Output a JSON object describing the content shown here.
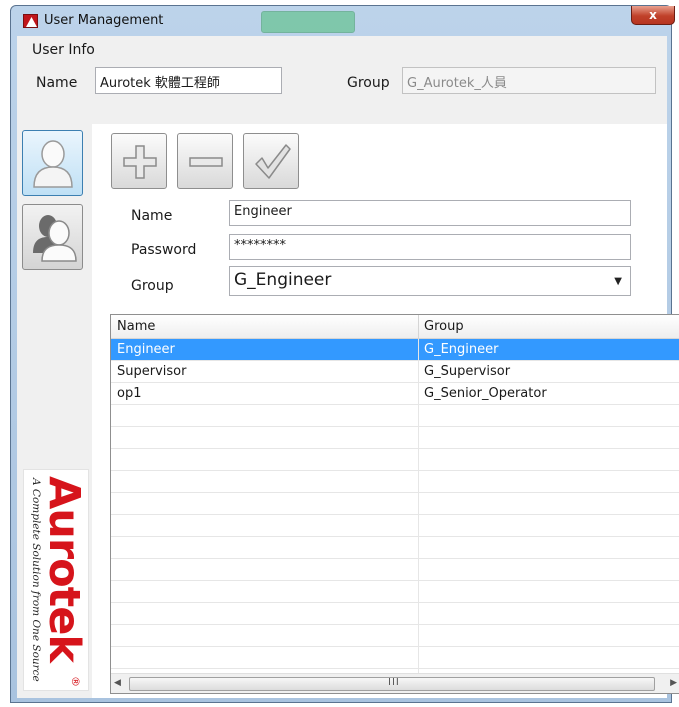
{
  "window": {
    "title": "User Management",
    "close_glyph": "x"
  },
  "user_info": {
    "section_label": "User Info",
    "name_label": "Name",
    "name_value": "Aurotek 軟體工程師",
    "group_label": "Group",
    "group_value": "G_Aurotek_人員"
  },
  "side": {
    "user_mode_icon": "user-icon",
    "group_mode_icon": "user-group-icon",
    "logo": {
      "word": "Aurotek",
      "tagline": "A Complete Solution from One Source",
      "reg_mark": "®"
    }
  },
  "toolbar": {
    "add_icon": "plus-icon",
    "remove_icon": "minus-icon",
    "apply_icon": "checkmark-icon"
  },
  "form": {
    "name_label": "Name",
    "name_value": "Engineer",
    "password_label": "Password",
    "password_value": "********",
    "group_label": "Group",
    "group_value": "G_Engineer"
  },
  "table": {
    "columns": [
      "Name",
      "Group"
    ],
    "rows": [
      {
        "name": "Engineer",
        "group": "G_Engineer",
        "selected": true
      },
      {
        "name": "Supervisor",
        "group": "G_Supervisor",
        "selected": false
      },
      {
        "name": "op1",
        "group": "G_Senior_Operator",
        "selected": false
      }
    ],
    "scroll_grip": "III"
  },
  "colors": {
    "selection": "#3399ff",
    "brand_red": "#d6141b",
    "close_button": "#c0412a"
  }
}
